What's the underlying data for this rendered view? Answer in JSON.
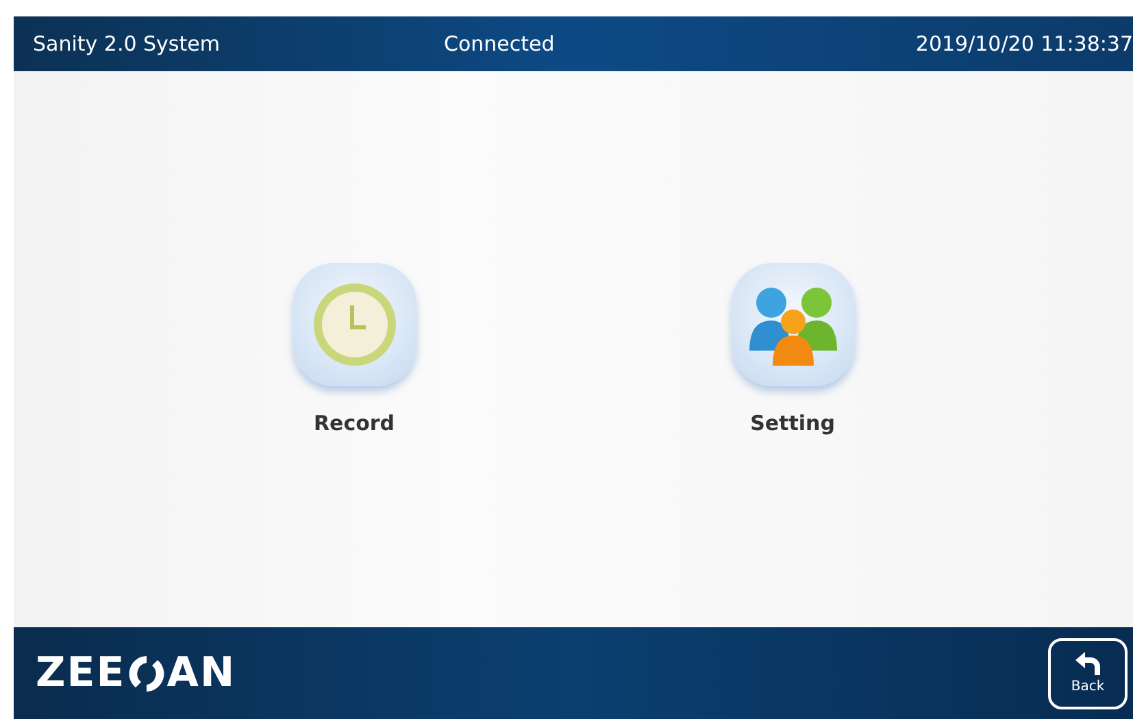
{
  "header": {
    "title": "Sanity 2.0 System",
    "status": "Connected",
    "datetime": "2019/10/20 11:38:37"
  },
  "apps": [
    {
      "label": "Record",
      "kind": "clock"
    },
    {
      "label": "Setting",
      "kind": "people"
    }
  ],
  "footer": {
    "logo_start": "ZEE",
    "logo_end": "AN",
    "back_label": "Back"
  }
}
